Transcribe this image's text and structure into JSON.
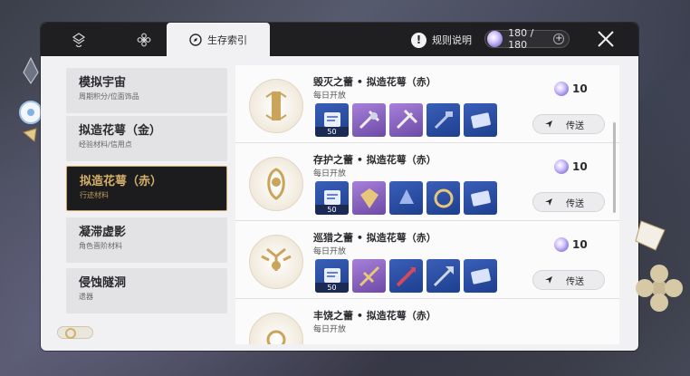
{
  "header": {
    "tabs": [
      {
        "icon": "cube-tab-icon"
      },
      {
        "icon": "flower-tab-icon"
      },
      {
        "icon": "compass-icon",
        "label": "生存索引"
      }
    ],
    "rules_label": "规则说明",
    "power": {
      "value": "180 / 180",
      "plus": "+"
    }
  },
  "menu": [
    {
      "title": "模拟宇宙",
      "sub": "周期积分/位面饰品"
    },
    {
      "title": "拟造花萼（金）",
      "sub": "经验材料/信用点"
    },
    {
      "title": "拟造花萼（赤）",
      "sub": "行迹材料",
      "active": true
    },
    {
      "title": "凝滞虚影",
      "sub": "角色晋阶材料"
    },
    {
      "title": "侵蚀隧洞",
      "sub": "遗器"
    }
  ],
  "rows": [
    {
      "title": "毁灭之蕾 • 拟造花萼（赤）",
      "sub": "每日开放",
      "cost": "10",
      "teleport": "传送",
      "qty": "50"
    },
    {
      "title": "存护之蕾 • 拟造花萼（赤）",
      "sub": "每日开放",
      "cost": "10",
      "teleport": "传送",
      "qty": "50"
    },
    {
      "title": "巡猎之蕾 • 拟造花萼（赤）",
      "sub": "每日开放",
      "cost": "10",
      "teleport": "传送",
      "qty": "50"
    },
    {
      "title": "丰饶之蕾 • 拟造花萼（赤）",
      "sub": "每日开放"
    }
  ],
  "colors": {
    "gold_accent": "#c9a45a",
    "active_bg": "#1c1c1e",
    "item_blue": "#2a4ea3",
    "item_purple": "#8a63c2"
  }
}
